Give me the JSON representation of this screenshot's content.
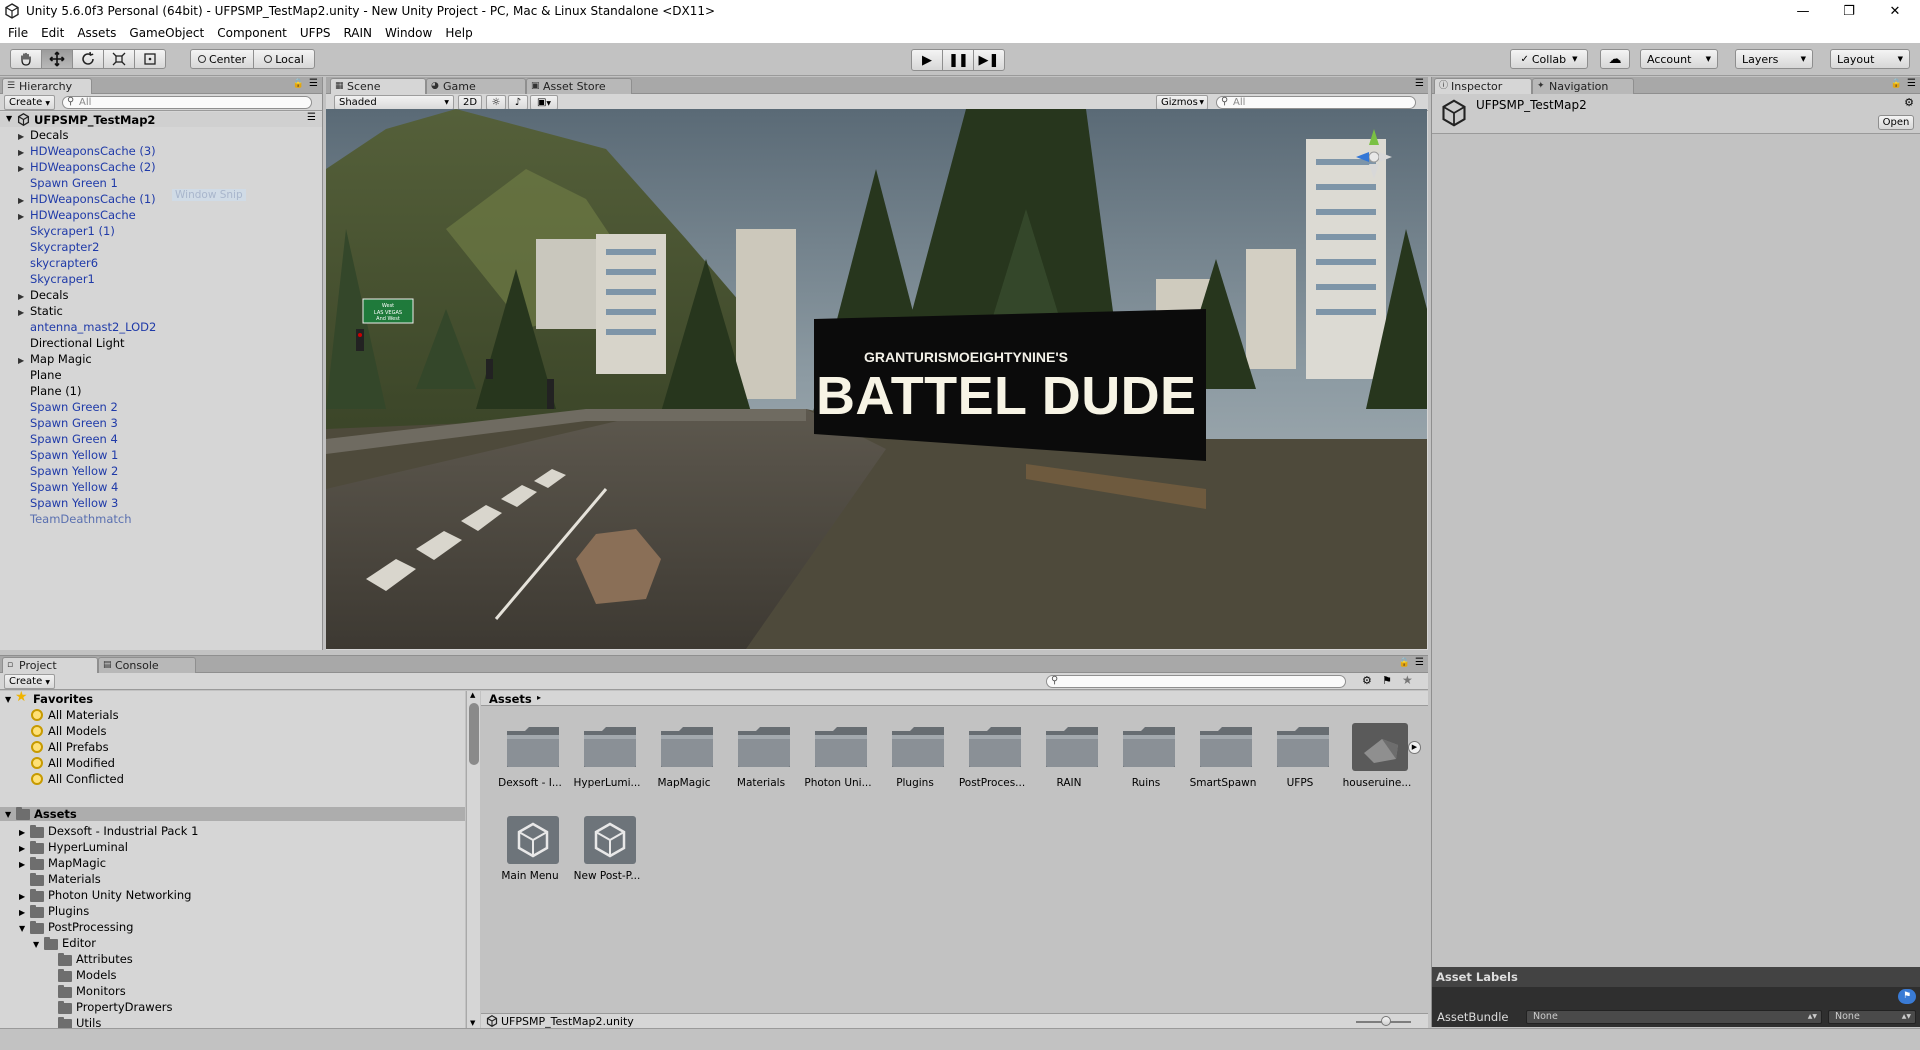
{
  "window": {
    "title": "Unity 5.6.0f3 Personal (64bit) - UFPSMP_TestMap2.unity - New Unity Project - PC, Mac & Linux Standalone <DX11>"
  },
  "menu": [
    "File",
    "Edit",
    "Assets",
    "GameObject",
    "Component",
    "UFPS",
    "RAIN",
    "Window",
    "Help"
  ],
  "toolbar": {
    "pivot_label": "Center",
    "space_label": "Local",
    "collab_label": "Collab",
    "account_label": "Account",
    "layers_label": "Layers",
    "layout_label": "Layout"
  },
  "hierarchy": {
    "tab": "Hierarchy",
    "create_label": "Create",
    "search_placeholder": "All",
    "scene_name": "UFPSMP_TestMap2",
    "items": [
      {
        "label": "Decals",
        "kind": "normal",
        "arrow": true
      },
      {
        "label": "HDWeaponsCache (3)",
        "kind": "prefab",
        "arrow": true
      },
      {
        "label": "HDWeaponsCache (2)",
        "kind": "prefab",
        "arrow": true
      },
      {
        "label": "Spawn Green 1",
        "kind": "prefab",
        "arrow": false
      },
      {
        "label": "HDWeaponsCache (1)",
        "kind": "prefab",
        "arrow": true
      },
      {
        "label": "HDWeaponsCache",
        "kind": "prefab",
        "arrow": true
      },
      {
        "label": "Skycraper1 (1)",
        "kind": "prefab",
        "arrow": false
      },
      {
        "label": "Skycrapter2",
        "kind": "prefab",
        "arrow": false
      },
      {
        "label": "skycrapter6",
        "kind": "prefab",
        "arrow": false
      },
      {
        "label": "Skycraper1",
        "kind": "prefab",
        "arrow": false
      },
      {
        "label": "Decals",
        "kind": "normal",
        "arrow": true
      },
      {
        "label": "Static",
        "kind": "normal",
        "arrow": true
      },
      {
        "label": "antenna_mast2_LOD2",
        "kind": "prefab",
        "arrow": false
      },
      {
        "label": "Directional Light",
        "kind": "normal",
        "arrow": false
      },
      {
        "label": "Map Magic",
        "kind": "normal",
        "arrow": true
      },
      {
        "label": "Plane",
        "kind": "normal",
        "arrow": false
      },
      {
        "label": "Plane (1)",
        "kind": "normal",
        "arrow": false
      },
      {
        "label": "Spawn Green 2",
        "kind": "prefab",
        "arrow": false
      },
      {
        "label": "Spawn Green 3",
        "kind": "prefab",
        "arrow": false
      },
      {
        "label": "Spawn Green 4",
        "kind": "prefab",
        "arrow": false
      },
      {
        "label": "Spawn Yellow 1",
        "kind": "prefab",
        "arrow": false
      },
      {
        "label": "Spawn Yellow 2",
        "kind": "prefab",
        "arrow": false
      },
      {
        "label": "Spawn Yellow 4",
        "kind": "prefab",
        "arrow": false
      },
      {
        "label": "Spawn Yellow 3",
        "kind": "prefab",
        "arrow": false
      },
      {
        "label": "TeamDeathmatch",
        "kind": "faded",
        "arrow": false
      }
    ],
    "ghost_label": "Window Snip"
  },
  "scene": {
    "tabs": [
      "Scene",
      "Game",
      "Asset Store"
    ],
    "shading_mode": "Shaded",
    "mode_2d": "2D",
    "gizmos_label": "Gizmos",
    "search_placeholder": "All",
    "billboard_top": "GRANTURISMOEIGHTYNINE'S",
    "billboard_main": "BATTEL DUDE",
    "sign_line1": "West",
    "sign_line2": "LAS VEGAS",
    "sign_line3": "And West"
  },
  "inspector": {
    "tabs": [
      "Inspector",
      "Navigation"
    ],
    "object_name": "UFPSMP_TestMap2",
    "open_label": "Open",
    "asset_labels_title": "Asset Labels",
    "assetbundle_label": "AssetBundle",
    "assetbundle_value": "None",
    "variant_value": "None"
  },
  "project": {
    "tabs": [
      "Project",
      "Console"
    ],
    "create_label": "Create",
    "favorites_label": "Favorites",
    "favorites": [
      "All Materials",
      "All Models",
      "All Prefabs",
      "All Modified",
      "All Conflicted"
    ],
    "assets_label": "Assets",
    "tree": [
      {
        "label": "Dexsoft - Industrial Pack 1",
        "depth": 1,
        "arrow": "right"
      },
      {
        "label": "HyperLuminal",
        "depth": 1,
        "arrow": "right"
      },
      {
        "label": "MapMagic",
        "depth": 1,
        "arrow": "right"
      },
      {
        "label": "Materials",
        "depth": 1,
        "arrow": "none"
      },
      {
        "label": "Photon Unity Networking",
        "depth": 1,
        "arrow": "right"
      },
      {
        "label": "Plugins",
        "depth": 1,
        "arrow": "right"
      },
      {
        "label": "PostProcessing",
        "depth": 1,
        "arrow": "down"
      },
      {
        "label": "Editor",
        "depth": 2,
        "arrow": "down"
      },
      {
        "label": "Attributes",
        "depth": 3,
        "arrow": "none"
      },
      {
        "label": "Models",
        "depth": 3,
        "arrow": "none"
      },
      {
        "label": "Monitors",
        "depth": 3,
        "arrow": "none"
      },
      {
        "label": "PropertyDrawers",
        "depth": 3,
        "arrow": "none"
      },
      {
        "label": "Utils",
        "depth": 3,
        "arrow": "none"
      }
    ],
    "breadcrumb": "Assets",
    "grid_items": [
      {
        "label": "Dexsoft - I...",
        "type": "folder"
      },
      {
        "label": "HyperLumi...",
        "type": "folder"
      },
      {
        "label": "MapMagic",
        "type": "folder"
      },
      {
        "label": "Materials",
        "type": "folder"
      },
      {
        "label": "Photon Uni...",
        "type": "folder"
      },
      {
        "label": "Plugins",
        "type": "folder"
      },
      {
        "label": "PostProces...",
        "type": "folder"
      },
      {
        "label": "RAIN",
        "type": "folder"
      },
      {
        "label": "Ruins",
        "type": "folder"
      },
      {
        "label": "SmartSpawn",
        "type": "folder"
      },
      {
        "label": "UFPS",
        "type": "folder"
      },
      {
        "label": "houseruine...",
        "type": "model"
      },
      {
        "label": "Main Menu",
        "type": "scene"
      },
      {
        "label": "New Post-P...",
        "type": "scene"
      }
    ],
    "status_file": "UFPSMP_TestMap2.unity"
  }
}
